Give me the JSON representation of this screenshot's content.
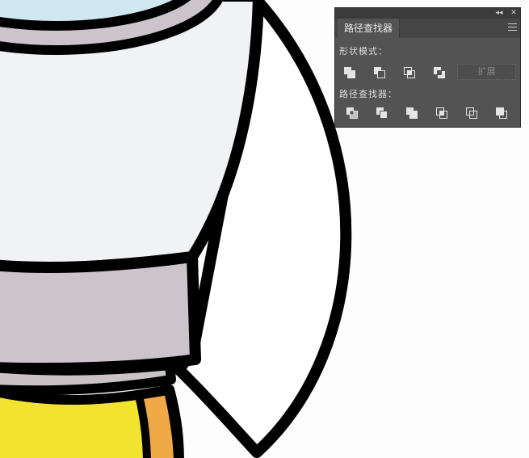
{
  "panel": {
    "tab_title": "路径查找器",
    "collapse_glyph": "◂◂",
    "close_glyph": "✕",
    "shape_modes_label": "形状模式：",
    "expand_label": "扩展",
    "pathfinders_label": "路径查找器：",
    "shape_mode_icons": [
      "unite-icon",
      "minus-front-icon",
      "intersect-icon",
      "exclude-icon"
    ],
    "pathfinder_icons": [
      "divide-icon",
      "trim-icon",
      "merge-icon",
      "crop-icon",
      "outline-icon",
      "minus-back-icon"
    ]
  },
  "colors": {
    "panel_bg": "#535353",
    "stroke": "#000000",
    "rocket_body": "#f1f2f4",
    "rocket_band": "#cbc4cb",
    "flame_yellow": "#f2e42e",
    "flame_orange": "#f0a947",
    "window_glass": "#cfe7ef"
  }
}
